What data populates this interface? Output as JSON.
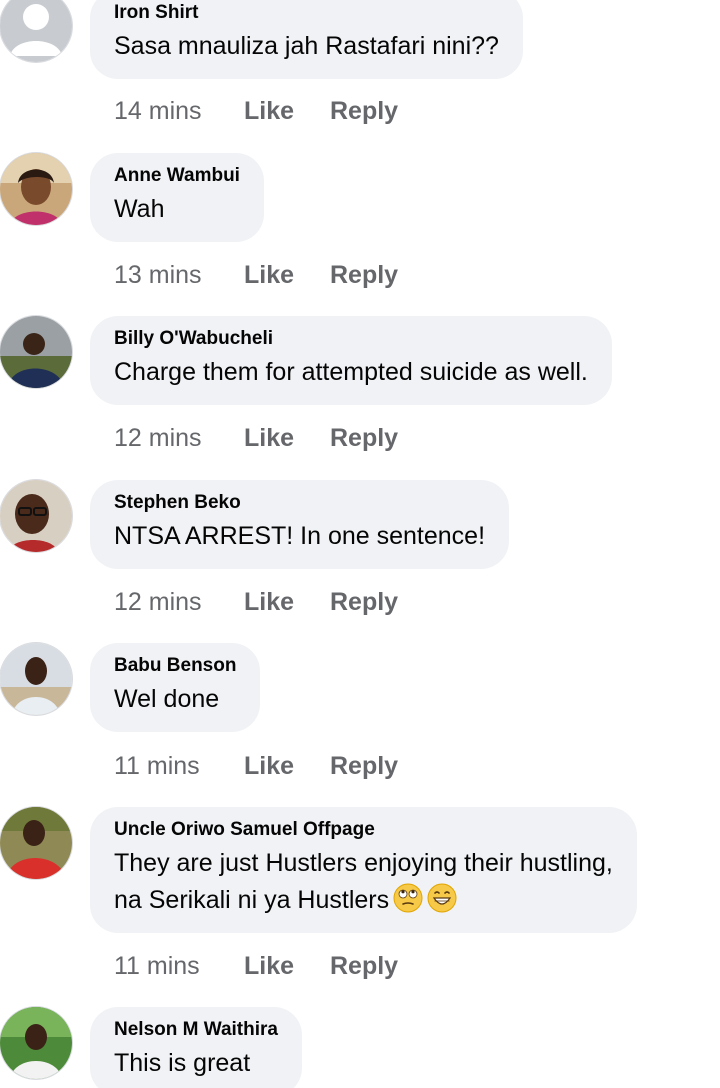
{
  "actions": {
    "like": "Like",
    "reply": "Reply"
  },
  "comments": [
    {
      "author": "Iron Shirt",
      "lines": [
        "Sasa mnauliza jah Rastafari nini??"
      ],
      "time": "14 mins",
      "avatar": "default-avatar"
    },
    {
      "author": "Anne Wambui",
      "lines": [
        "Wah"
      ],
      "time": "13 mins",
      "avatar": "profile-photo"
    },
    {
      "author": "Billy O'Wabucheli",
      "lines": [
        "Charge them for attempted suicide as well."
      ],
      "time": "12 mins",
      "avatar": "profile-photo"
    },
    {
      "author": "Stephen Beko",
      "lines": [
        "NTSA ARREST! In one sentence!"
      ],
      "time": "12 mins",
      "avatar": "profile-photo"
    },
    {
      "author": "Babu Benson",
      "lines": [
        "Wel done"
      ],
      "time": "11 mins",
      "avatar": "profile-photo"
    },
    {
      "author": "Uncle Oriwo Samuel Offpage",
      "lines": [
        "They are just Hustlers enjoying their hustling,",
        "na Serikali ni ya Hustlers"
      ],
      "emojis": [
        "face-with-rolling-eyes-emoji",
        "grinning-face-emoji"
      ],
      "time": "11 mins",
      "avatar": "profile-photo"
    },
    {
      "author": "Nelson M Waithira",
      "lines": [
        "This is great"
      ],
      "time": "",
      "avatar": "profile-photo"
    }
  ],
  "colors": {
    "bubble": "#f0f2f5",
    "meta_text": "#65676b",
    "name_text": "#050505"
  }
}
